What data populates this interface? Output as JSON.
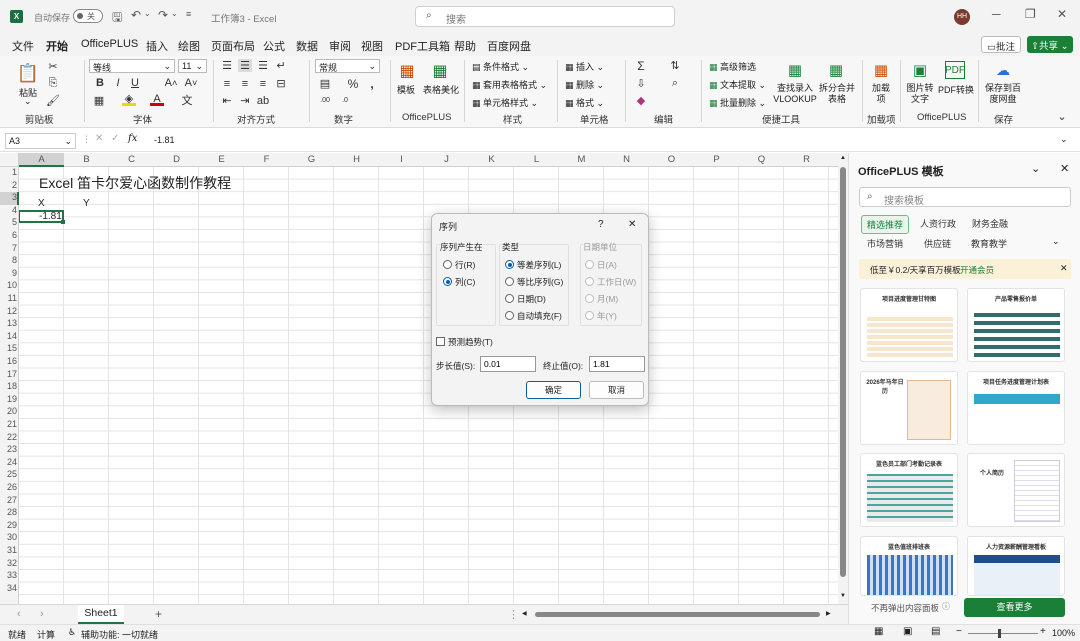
{
  "titlebar": {
    "autosave_label": "自动保存",
    "toggle_state": "关",
    "filename": "工作簿3 - Excel",
    "search_placeholder": "搜索",
    "user_initials": "HH"
  },
  "menu": {
    "items": [
      "文件",
      "开始",
      "OfficePLUS",
      "插入",
      "绘图",
      "页面布局",
      "公式",
      "数据",
      "审阅",
      "视图",
      "PDF工具箱",
      "帮助",
      "百度网盘"
    ],
    "active": "开始",
    "comment_btn": "批注",
    "share_btn": "共享"
  },
  "ribbon": {
    "paste": "粘贴",
    "clipboard": "剪贴板",
    "font_name": "等线",
    "font_size": "11",
    "font_group": "字体",
    "align_group": "对齐方式",
    "number_format": "常规",
    "number_group": "数字",
    "template": "模板",
    "table_beautify": "表格美化",
    "officeplus_group": "OfficePLUS",
    "cond_format": "条件格式",
    "table_format": "套用表格格式",
    "cell_style": "单元格样式",
    "style_group": "样式",
    "insert": "插入",
    "delete": "删除",
    "format": "格式",
    "cells_group": "单元格",
    "editing_group": "编辑",
    "adv_filter": "高级筛选",
    "text_extract": "文本提取",
    "batch_delete": "批量删除",
    "lookup": "查找录入VLOOKUP",
    "split_merge": "拆分合并表格",
    "tools_group": "便捷工具",
    "addin": "加载项",
    "addin_group": "加载项",
    "img2text": "图片转文字",
    "pdf_convert": "PDF转换",
    "officeplus_group2": "OfficePLUS",
    "save_baidu": "保存到百度网盘",
    "save_group": "保存"
  },
  "formula_bar": {
    "cell_ref": "A3",
    "value": "-1.81",
    "fx": "fx"
  },
  "grid": {
    "columns": [
      "A",
      "B",
      "C",
      "D",
      "E",
      "F",
      "G",
      "H",
      "I",
      "J",
      "K",
      "L",
      "M",
      "N",
      "O",
      "P",
      "Q",
      "R"
    ],
    "rows": [
      "1",
      "2",
      "3",
      "4",
      "5",
      "6",
      "7",
      "8",
      "9",
      "10",
      "11",
      "12",
      "13",
      "14",
      "15",
      "16",
      "17",
      "18",
      "19",
      "20",
      "21",
      "22",
      "23",
      "24",
      "25",
      "26",
      "27",
      "28",
      "29",
      "30",
      "31",
      "32",
      "33",
      "34"
    ],
    "title": "Excel 笛卡尔爱心函数制作教程",
    "x_header": "X",
    "y_header": "Y",
    "a3": "-1.81"
  },
  "sheet": {
    "tab": "Sheet1",
    "add": "+"
  },
  "status": {
    "ready": "就绪",
    "calc": "计算",
    "accessibility": "辅助功能: 一切就绪",
    "zoom": "100%"
  },
  "panel": {
    "title": "OfficePLUS 模板",
    "search_placeholder": "搜索模板",
    "chips": [
      "精选推荐",
      "人资行政",
      "财务金融",
      "市场营销",
      "供应链",
      "教育教学"
    ],
    "promo": "低至￥0.2/天享百万模板",
    "promo_link": "开通会员",
    "templates": [
      "项目进度管理甘特图",
      "产品零售报价单",
      "2026年马年日历",
      "项目任务进度管理计划表",
      "蓝色员工部门考勤记录表",
      "个人简历",
      "蓝色值班排班表",
      "人力资源薪酬管理看板"
    ],
    "no_popup": "不再弹出内容面板",
    "view_more": "查看更多"
  },
  "dialog": {
    "title": "序列",
    "help": "?",
    "close": "✕",
    "series_in_label": "序列产生在",
    "row": "行(R)",
    "column": "列(C)",
    "type_label": "类型",
    "linear": "等差序列(L)",
    "growth": "等比序列(G)",
    "date": "日期(D)",
    "autofill": "自动填充(F)",
    "date_unit_label": "日期单位",
    "day": "日(A)",
    "weekday": "工作日(W)",
    "month": "月(M)",
    "year": "年(Y)",
    "trend": "预测趋势(T)",
    "step_label": "步长值(S):",
    "step_value": "0.01",
    "stop_label": "终止值(O):",
    "stop_value": "1.81",
    "ok": "确定",
    "cancel": "取消"
  },
  "colors": {
    "accent": "#1a7f37",
    "selection": "#217346",
    "dialog_blue": "#0a5ea8"
  }
}
